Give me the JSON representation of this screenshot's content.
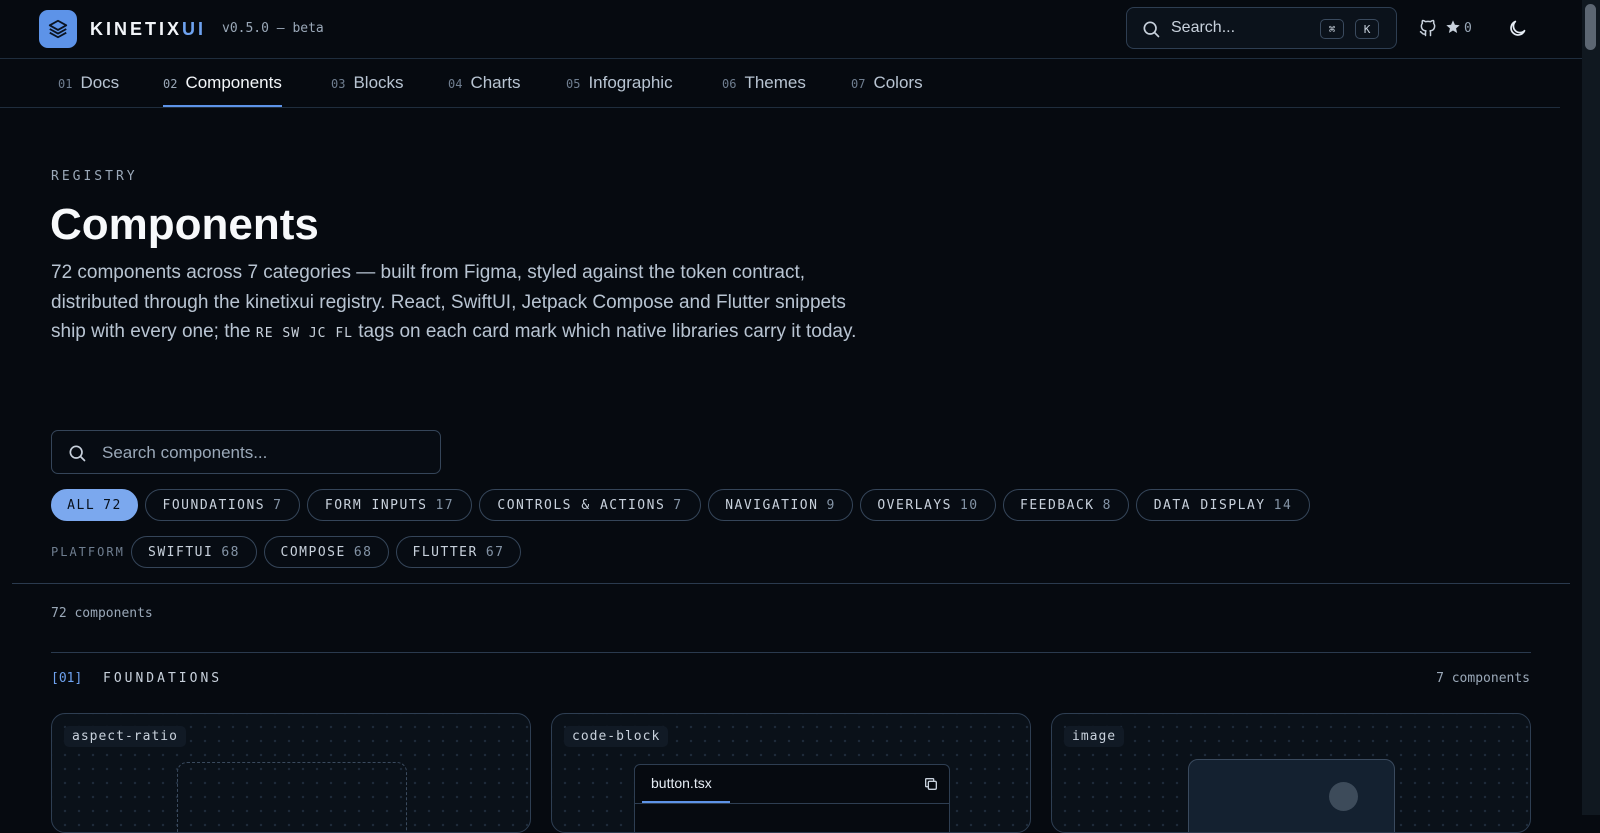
{
  "header": {
    "brand_main": "KINETIX",
    "brand_accent": "UI",
    "version": "v0.5.0 — beta",
    "search_placeholder": "Search...",
    "shortcut_mod": "⌘",
    "shortcut_key": "K",
    "star_count": "0",
    "icons": [
      "layers-icon",
      "search-icon",
      "github-icon",
      "star-icon",
      "moon-icon"
    ]
  },
  "tabs": [
    {
      "num": "01",
      "label": "Docs"
    },
    {
      "num": "02",
      "label": "Components",
      "active": true
    },
    {
      "num": "03",
      "label": "Blocks"
    },
    {
      "num": "04",
      "label": "Charts"
    },
    {
      "num": "05",
      "label": "Infographic"
    },
    {
      "num": "06",
      "label": "Themes"
    },
    {
      "num": "07",
      "label": "Colors"
    }
  ],
  "hero": {
    "eyebrow": "REGISTRY",
    "title": "Components",
    "desc_before": "72 components across 7 categories — built from Figma, styled against the token contract, distributed through the kinetixui registry. React, SwiftUI, Jetpack Compose and Flutter snippets ship with every one; the ",
    "desc_tags": "RE SW JC FL",
    "desc_after": " tags on each card mark which native libraries carry it today."
  },
  "search": {
    "placeholder": "Search components..."
  },
  "filters": {
    "categories": [
      {
        "label": "ALL",
        "count": "72",
        "active": true
      },
      {
        "label": "FOUNDATIONS",
        "count": "7"
      },
      {
        "label": "FORM INPUTS",
        "count": "17"
      },
      {
        "label": "CONTROLS & ACTIONS",
        "count": "7"
      },
      {
        "label": "NAVIGATION",
        "count": "9"
      },
      {
        "label": "OVERLAYS",
        "count": "10"
      },
      {
        "label": "FEEDBACK",
        "count": "8"
      },
      {
        "label": "DATA DISPLAY",
        "count": "14"
      }
    ],
    "platform_label": "PLATFORM",
    "platforms": [
      {
        "label": "SWIFTUI",
        "count": "68"
      },
      {
        "label": "COMPOSE",
        "count": "68"
      },
      {
        "label": "FLUTTER",
        "count": "67"
      }
    ]
  },
  "results": {
    "count_text": "72 components"
  },
  "section": {
    "index": "[01]",
    "name": "FOUNDATIONS",
    "count_text": "7 components",
    "cards": [
      {
        "tag": "aspect-ratio"
      },
      {
        "tag": "code-block",
        "file": "button.tsx"
      },
      {
        "tag": "image"
      }
    ]
  },
  "colors": {
    "background": "#060a10",
    "accent": "#5d93e8",
    "active_chip": "#7ba8ee",
    "border": "#2e3e52"
  }
}
